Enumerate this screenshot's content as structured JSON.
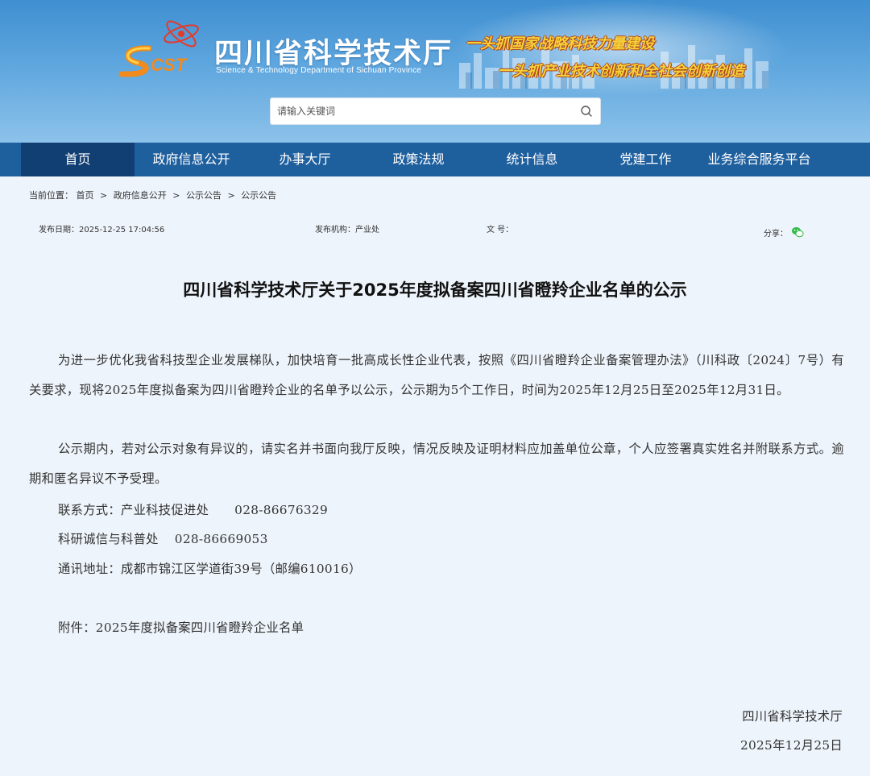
{
  "header": {
    "site_title": "四川省科学技术厅",
    "site_subtitle": "Science & Technology Department of Sichuan Province",
    "logo_text": "SCST",
    "slogan_1": "一头抓国家战略科技力量建设",
    "slogan_2": "一头抓产业技术创新和全社会创新创造",
    "colors": {
      "header_top": "#3f8fd1",
      "nav": "#1e5f9e",
      "nav_active": "#123f73",
      "slogan": "#f6d23a"
    }
  },
  "search": {
    "placeholder": "请输入关键词",
    "icon": "search-icon"
  },
  "nav": {
    "items": [
      "首页",
      "政府信息公开",
      "办事大厅",
      "政策法规",
      "统计信息",
      "党建工作",
      "业务综合服务平台"
    ],
    "active_index": 0
  },
  "breadcrumb": {
    "label": "当前位置：",
    "items": [
      "首页",
      "政府信息公开",
      "公示公告",
      "公示公告"
    ]
  },
  "meta": {
    "date_label": "发布日期：",
    "date": "2025-12-25 17:04:56",
    "org_label": "发布机构：",
    "org": "产业处",
    "num_label": "文 号：",
    "num": "",
    "share_label": "分享：",
    "share_icon": "wechat-icon"
  },
  "article": {
    "title": "四川省科学技术厅关于2025年度拟备案四川省瞪羚企业名单的公示",
    "para1": "为进一步优化我省科技型企业发展梯队，加快培育一批高成长性企业代表，按照《四川省瞪羚企业备案管理办法》（川科政〔2024〕7号）有关要求，现将2025年度拟备案为四川省瞪羚企业的名单予以公示，公示期为5个工作日，时间为2025年12月25日至2025年12月31日。",
    "para2": "公示期内，若对公示对象有异议的，请实名并书面向我厅反映，情况反映及证明材料应加盖单位公章，个人应签署真实姓名并附联系方式。逾期和匿名异议不予受理。",
    "contact1_label": "联系方式：产业科技促进处",
    "contact1_phone": "028-86676329",
    "contact2_label": "科研诚信与科普处",
    "contact2_phone": "028-86669053",
    "address": "通讯地址：成都市锦江区学道街39号（邮编610016）",
    "attachment": "附件：2025年度拟备案四川省瞪羚企业名单",
    "sign_org": "四川省科学技术厅",
    "sign_date": "2025年12月25日"
  }
}
